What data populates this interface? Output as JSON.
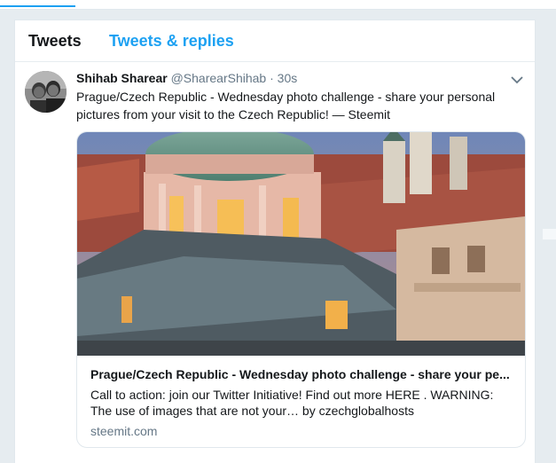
{
  "tabs": [
    {
      "label": "Tweets"
    },
    {
      "label": "Tweets & replies"
    }
  ],
  "tweet": {
    "name": "Shihab Sharear",
    "handle": "@SharearShihab",
    "separator": "·",
    "time": "30s",
    "text": "Prague/Czech Republic - Wednesday photo challenge - share your personal pictures from your visit to the Czech Republic! — Steemit",
    "card": {
      "title": "Prague/Czech Republic - Wednesday photo challenge - share your pe...",
      "description": "Call to action: join our Twitter Initiative! Find out more HERE . WARNING: The use of images that are not your… by czechglobalhosts",
      "domain": "steemit.com"
    }
  },
  "colors": {
    "accent": "#1da1f2",
    "text": "#14171a",
    "muted": "#657786",
    "border": "#e1e8ed"
  }
}
